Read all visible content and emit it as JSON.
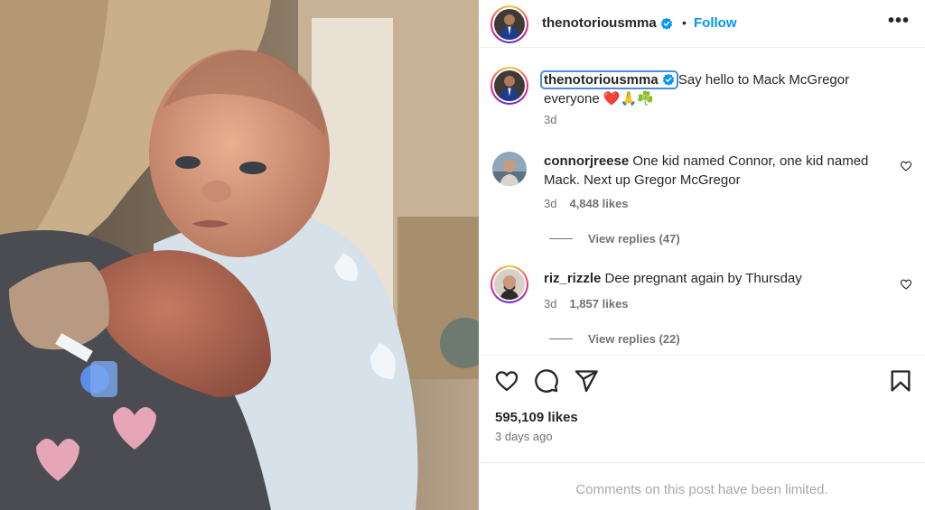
{
  "post": {
    "username": "thenotoriousmma",
    "dot": "•",
    "follow_label": "Follow",
    "more_label": "•••"
  },
  "caption": {
    "username": "thenotoriousmma",
    "text": "Say hello to Mack McGregor everyone ❤️🙏☘️",
    "time": "3d"
  },
  "comments": [
    {
      "username": "connorjreese",
      "text": "One kid named Connor, one kid named Mack. Next up Gregor McGregor",
      "time": "3d",
      "likes": "4,848 likes",
      "replies": "View replies (47)"
    },
    {
      "username": "riz_rizzle",
      "text": "Dee pregnant again by Thursday",
      "time": "3d",
      "likes": "1,857 likes",
      "replies": "View replies (22)"
    }
  ],
  "footer": {
    "likes": "595,109 likes",
    "date": "3 days ago",
    "comments_limited": "Comments on this post have been limited."
  },
  "icons": {
    "verified": "verified-badge-icon",
    "like": "heart-icon",
    "comment": "comment-icon",
    "share": "share-icon",
    "save": "bookmark-icon",
    "more": "more-options-icon"
  },
  "colors": {
    "link": "#0095f6",
    "verified": "#0095f6",
    "secondary_text": "#737373",
    "muted_text": "#a8a8a8"
  }
}
